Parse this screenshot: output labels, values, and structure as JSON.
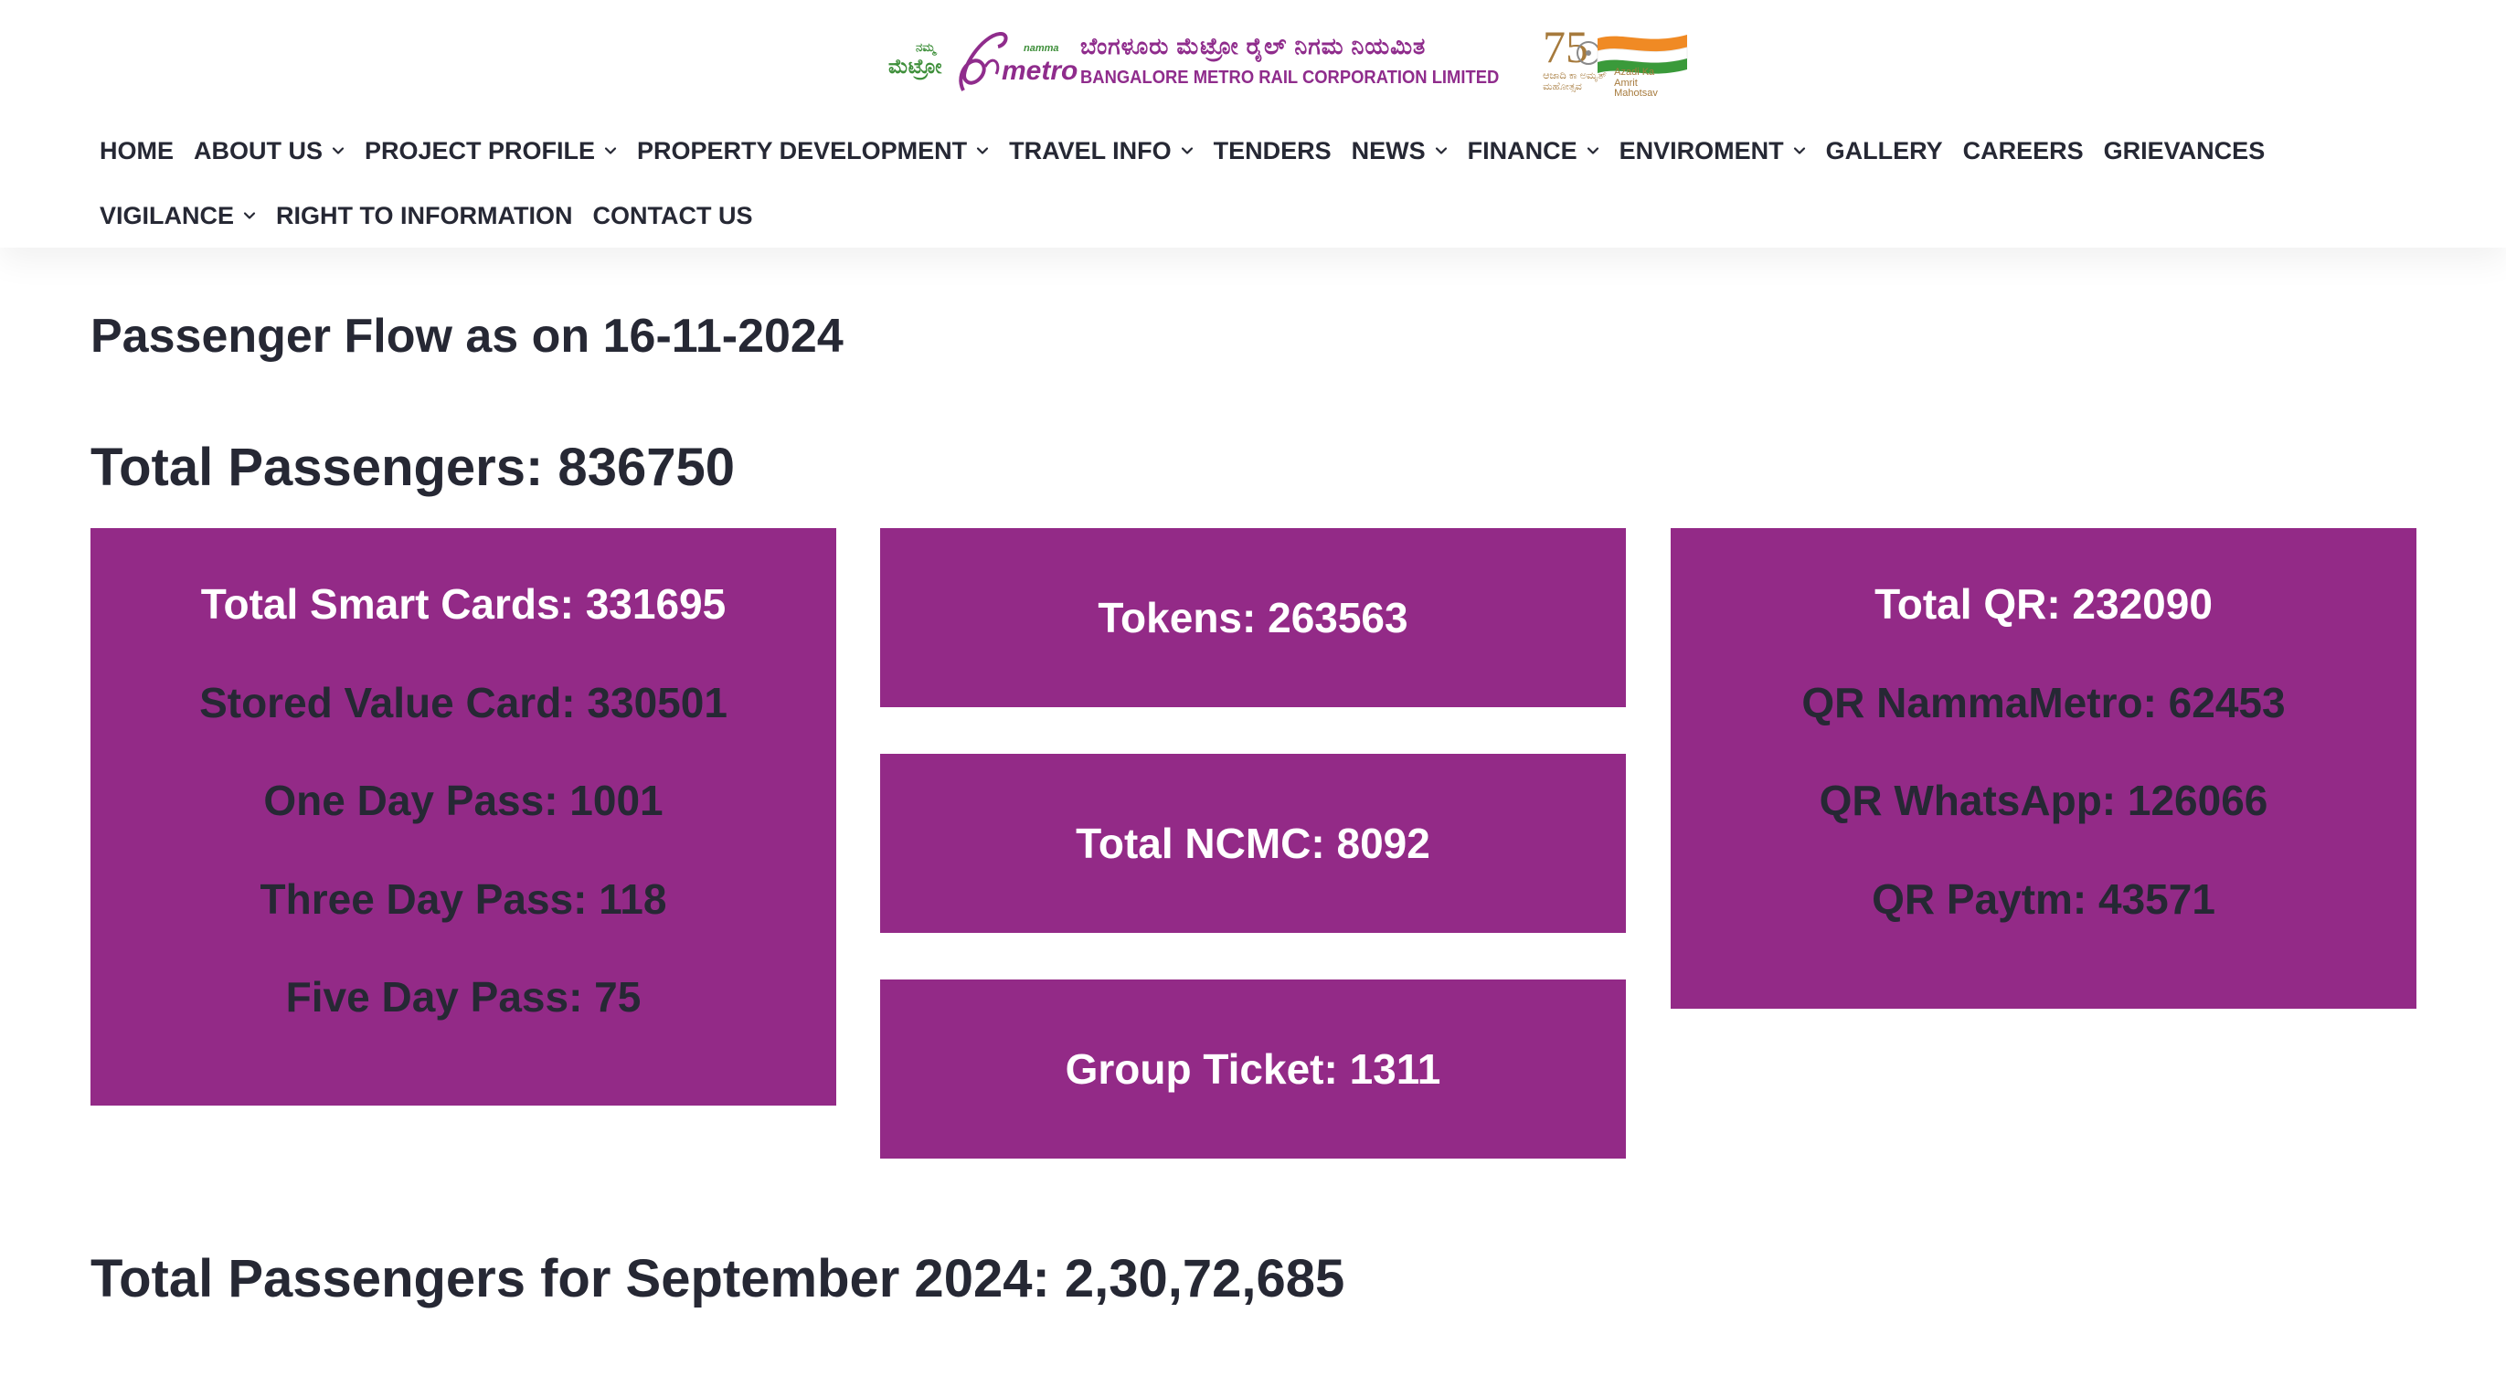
{
  "brand": {
    "namma_metro_kannada_small": "ನಮ್ಮ",
    "namma_metro_kannada": "ಮೆಟ್ರೋ",
    "namma_metro_small": "namma",
    "namma_metro": "metro",
    "org_name_kannada": "ಬೆಂಗಳೂರು ಮೆಟ್ರೋ ರೈಲ್ ನಿಗಮ ನಿಯಮಿತ",
    "org_name_english": "BANGALORE METRO RAIL CORPORATION LIMITED",
    "azadi_kannada": "ಆಜಾದಿ ಕಾ ಅಮೃತ್ ಮಹೋತ್ಸವ",
    "azadi_english": "Azadi Ka Amrit Mahotsav",
    "azadi_number": "75"
  },
  "nav": {
    "items": [
      {
        "label": "HOME",
        "dropdown": false
      },
      {
        "label": "ABOUT US",
        "dropdown": true
      },
      {
        "label": "PROJECT PROFILE",
        "dropdown": true
      },
      {
        "label": "PROPERTY DEVELOPMENT",
        "dropdown": true
      },
      {
        "label": "TRAVEL INFO",
        "dropdown": true
      },
      {
        "label": "TENDERS",
        "dropdown": false
      },
      {
        "label": "NEWS",
        "dropdown": true
      },
      {
        "label": "FINANCE",
        "dropdown": true
      },
      {
        "label": "ENVIROMENT",
        "dropdown": true
      },
      {
        "label": "GALLERY",
        "dropdown": false
      },
      {
        "label": "CAREERS",
        "dropdown": false
      },
      {
        "label": "GRIEVANCES",
        "dropdown": false
      },
      {
        "label": "VIGILANCE",
        "dropdown": true
      },
      {
        "label": "RIGHT TO INFORMATION",
        "dropdown": false
      },
      {
        "label": "CONTACT US",
        "dropdown": false
      }
    ]
  },
  "main": {
    "flow_title": "Passenger Flow as on 16-11-2024",
    "total_passengers": "Total Passengers: 836750",
    "smart_cards": {
      "total": "Total Smart Cards: 331695",
      "stored_value": "Stored Value Card: 330501",
      "one_day": "One Day Pass: 1001",
      "three_day": "Three Day Pass: 118",
      "five_day": "Five Day Pass: 75"
    },
    "tokens": "Tokens: 263563",
    "ncmc": "Total NCMC: 8092",
    "group_ticket": "Group Ticket: 1311",
    "qr": {
      "total": "Total QR: 232090",
      "namma_metro": "QR NammaMetro: 62453",
      "whatsapp": "QR WhatsApp: 126066",
      "paytm": "QR Paytm: 43571"
    },
    "september_total": "Total Passengers for September 2024: 2,30,72,685"
  },
  "colors": {
    "card_bg": "#932a87",
    "card_head_text": "#ffffff",
    "card_sub_text": "#262834",
    "heading_text": "#262834",
    "brand_purple": "#8f2c8c",
    "brand_green": "#3e8f3a"
  }
}
